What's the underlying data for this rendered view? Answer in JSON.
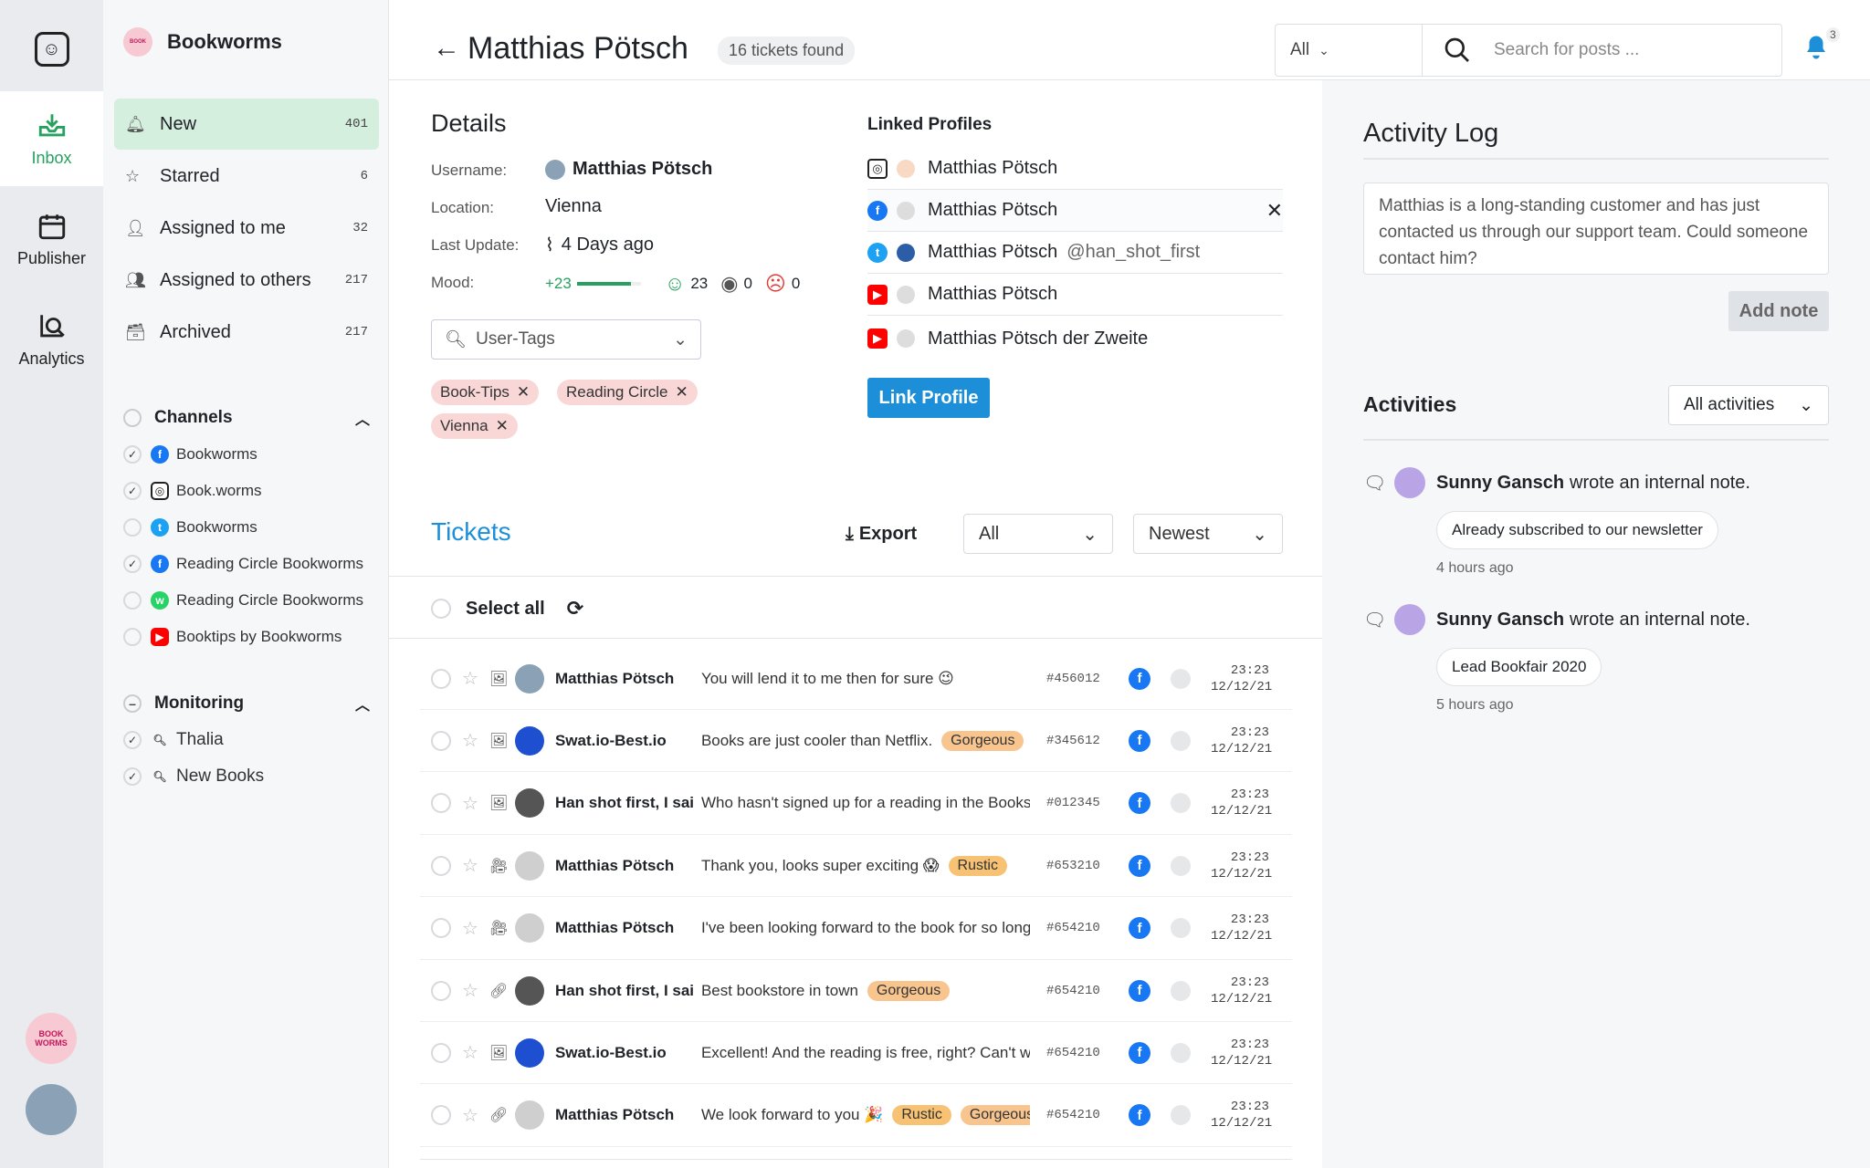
{
  "rail": {
    "items": [
      {
        "label": "Inbox",
        "icon": "inbox-icon"
      },
      {
        "label": "Publisher",
        "icon": "calendar-icon"
      },
      {
        "label": "Analytics",
        "icon": "analytics-icon"
      }
    ],
    "bottom_logo_text": "BOOK WORMS"
  },
  "sidebar": {
    "brand": "Bookworms",
    "nav": [
      {
        "label": "New",
        "count": "401",
        "icon": "bell-icon"
      },
      {
        "label": "Starred",
        "count": "6",
        "icon": "star-icon"
      },
      {
        "label": "Assigned to me",
        "count": "32",
        "icon": "user-icon"
      },
      {
        "label": "Assigned to others",
        "count": "217",
        "icon": "users-icon"
      },
      {
        "label": "Archived",
        "count": "217",
        "icon": "archive-icon"
      }
    ],
    "channels_title": "Channels",
    "channels": [
      {
        "label": "Bookworms",
        "network": "facebook",
        "checked": true
      },
      {
        "label": "Book.worms",
        "network": "instagram",
        "checked": true
      },
      {
        "label": "Bookworms",
        "network": "twitter",
        "checked": false
      },
      {
        "label": "Reading Circle Bookworms",
        "network": "facebook",
        "checked": true
      },
      {
        "label": "Reading Circle Bookworms",
        "network": "whatsapp",
        "checked": false
      },
      {
        "label": "Booktips by Bookworms",
        "network": "youtube",
        "checked": false
      }
    ],
    "monitoring_title": "Monitoring",
    "monitoring": [
      {
        "label": "Thalia",
        "checked": true
      },
      {
        "label": "New Books",
        "checked": true
      }
    ]
  },
  "header": {
    "name": "Matthias Pötsch",
    "tickets_found": "16 tickets found",
    "filter": "All",
    "search_placeholder": "Search for posts ...",
    "notifications": "3"
  },
  "details": {
    "title": "Details",
    "username_label": "Username:",
    "username": "Matthias Pötsch",
    "location_label": "Location:",
    "location": "Vienna",
    "update_label": "Last Update:",
    "update": "4 Days ago",
    "mood_label": "Mood:",
    "mood_score": "+23",
    "mood_bar_fraction": 0.85,
    "mood_happy": "23",
    "mood_neutral": "0",
    "mood_sad": "0",
    "tags_placeholder": "User-Tags",
    "tags": [
      "Book-Tips",
      "Reading Circle",
      "Vienna"
    ]
  },
  "linked": {
    "title": "Linked Profiles",
    "profiles": [
      {
        "network": "instagram",
        "name": "Matthias Pötsch",
        "handle": ""
      },
      {
        "network": "facebook",
        "name": "Matthias Pötsch",
        "handle": ""
      },
      {
        "network": "twitter",
        "name": "Matthias Pötsch",
        "handle": "@han_shot_first"
      },
      {
        "network": "youtube",
        "name": "Matthias Pötsch",
        "handle": ""
      },
      {
        "network": "youtube",
        "name": "Matthias Pötsch der Zweite",
        "handle": ""
      }
    ],
    "link_button": "Link Profile"
  },
  "tickets": {
    "title": "Tickets",
    "export": "Export",
    "filter": "All",
    "sort": "Newest",
    "select_all": "Select all",
    "rows": [
      {
        "user": "Matthias Pötsch",
        "msg": "You will lend it to me then for sure 😉",
        "tags": [],
        "id": "#456012",
        "time": "23:23",
        "date": "12/12/21",
        "type": "image"
      },
      {
        "user": "Swat.io-Best.io",
        "msg": "Books are just cooler than Netflix.",
        "tags": [
          "Gorgeous"
        ],
        "id": "#345612",
        "time": "23:23",
        "date": "12/12/21",
        "type": "image"
      },
      {
        "user": "Han shot first, I said",
        "msg": "Who hasn't signed up for a reading in the Bookstore yet?",
        "tags": [],
        "id": "#012345",
        "time": "23:23",
        "date": "12/12/21",
        "type": "image"
      },
      {
        "user": "Matthias Pötsch",
        "msg": "Thank you, looks super exciting 😱",
        "tags": [
          "Rustic"
        ],
        "id": "#653210",
        "time": "23:23",
        "date": "12/12/21",
        "type": "video"
      },
      {
        "user": "Matthias Pötsch",
        "msg": "I've been looking forward to the book for so long",
        "tags": [],
        "id": "#654210",
        "time": "23:23",
        "date": "12/12/21",
        "type": "video"
      },
      {
        "user": "Han shot first, I said",
        "msg": "Best bookstore in town",
        "tags": [
          "Gorgeous"
        ],
        "id": "#654210",
        "time": "23:23",
        "date": "12/12/21",
        "type": "link"
      },
      {
        "user": "Swat.io-Best.io",
        "msg": "Excellent! And the reading is free, right? Can't wait",
        "tags": [],
        "id": "#654210",
        "time": "23:23",
        "date": "12/12/21",
        "type": "image"
      },
      {
        "user": "Matthias Pötsch",
        "msg": "We look forward to you 🎉",
        "tags": [
          "Rustic",
          "Gorgeous"
        ],
        "id": "#654210",
        "time": "23:23",
        "date": "12/12/21",
        "type": "link"
      }
    ]
  },
  "activity": {
    "title": "Activity Log",
    "note_text": "Matthias is a long-standing customer and has just contacted us through our support team. Could someone contact him?",
    "add_note": "Add note",
    "activities_title": "Activities",
    "activities_filter": "All activities",
    "items": [
      {
        "author": "Sunny Gansch",
        "action": "wrote an internal note.",
        "note": "Already subscribed to our newsletter",
        "ago": "4 hours ago"
      },
      {
        "author": "Sunny Gansch",
        "action": "wrote an internal note.",
        "note": "Lead Bookfair 2020",
        "ago": "5 hours ago"
      }
    ]
  },
  "colors": {
    "accent_green": "#27a160",
    "accent_blue": "#1d8fd8",
    "tag_pink": "#f9d7d7",
    "tag_orange": "#f8c58f"
  }
}
